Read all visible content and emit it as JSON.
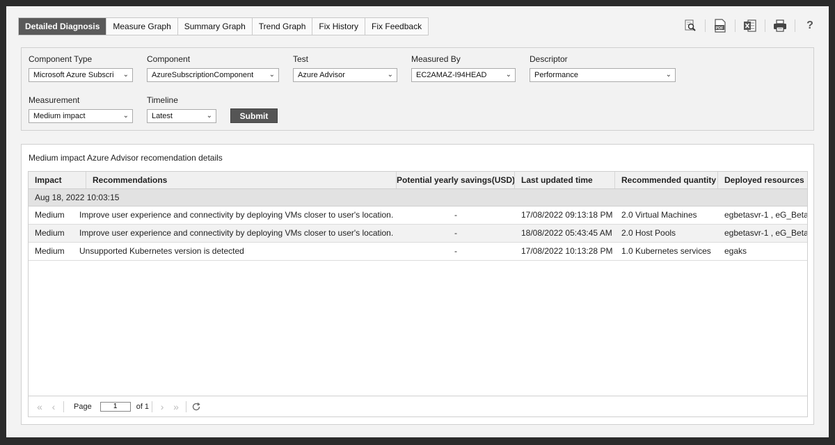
{
  "tabs": [
    {
      "label": "Detailed Diagnosis",
      "active": true
    },
    {
      "label": "Measure Graph",
      "active": false
    },
    {
      "label": "Summary Graph",
      "active": false
    },
    {
      "label": "Trend Graph",
      "active": false
    },
    {
      "label": "Fix History",
      "active": false
    },
    {
      "label": "Fix Feedback",
      "active": false
    }
  ],
  "toolbar": {
    "icons": [
      "search-icon",
      "pdf-icon",
      "excel-icon",
      "print-icon",
      "help-icon"
    ],
    "pdf_text": "PDF",
    "help_text": "?"
  },
  "filters": {
    "component_type": {
      "label": "Component Type",
      "value": "Microsoft Azure Subscri"
    },
    "component": {
      "label": "Component",
      "value": "AzureSubscriptionComponent"
    },
    "test": {
      "label": "Test",
      "value": "Azure Advisor"
    },
    "measured_by": {
      "label": "Measured By",
      "value": "EC2AMAZ-I94HEAD"
    },
    "descriptor": {
      "label": "Descriptor",
      "value": "Performance"
    },
    "measurement": {
      "label": "Measurement",
      "value": "Medium impact"
    },
    "timeline": {
      "label": "Timeline",
      "value": "Latest"
    },
    "submit_label": "Submit"
  },
  "results": {
    "title": "Medium impact Azure Advisor recomendation details",
    "columns": [
      "Impact",
      "Recommendations",
      "Potential yearly savings(USD)",
      "Last updated time",
      "Recommended quantity",
      "Deployed resources"
    ],
    "group_label": "Aug 18, 2022 10:03:15",
    "rows": [
      [
        "Medium",
        "Improve user experience and connectivity by deploying VMs closer to user's location.",
        "-",
        "17/08/2022 09:13:18 PM",
        "2.0 Virtual Machines",
        "egbetasvr-1 , eG_Beta"
      ],
      [
        "Medium",
        "Improve user experience and connectivity by deploying VMs closer to user's location.",
        "-",
        "18/08/2022 05:43:45 AM",
        "2.0 Host Pools",
        "egbetasvr-1 , eG_Beta"
      ],
      [
        "Medium",
        "Unsupported Kubernetes version is detected",
        "-",
        "17/08/2022 10:13:28 PM",
        "1.0 Kubernetes services",
        "egaks"
      ]
    ]
  },
  "pager": {
    "page_label": "Page",
    "page_value": "1",
    "of_label": "of 1"
  },
  "colors": {
    "active_tab": "#5a5a5a",
    "submit": "#555555",
    "frame": "#2b2b2b"
  }
}
